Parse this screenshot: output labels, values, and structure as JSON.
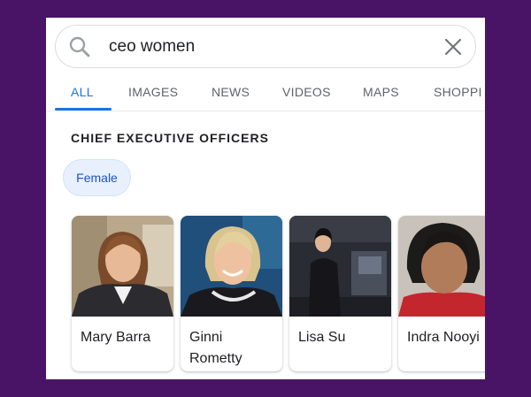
{
  "search": {
    "query": "ceo women",
    "search_icon": "search-icon",
    "clear_icon": "close-icon"
  },
  "tabs": [
    {
      "label": "ALL",
      "active": true
    },
    {
      "label": "IMAGES",
      "active": false
    },
    {
      "label": "NEWS",
      "active": false
    },
    {
      "label": "VIDEOS",
      "active": false
    },
    {
      "label": "MAPS",
      "active": false
    },
    {
      "label": "SHOPPI",
      "active": false
    }
  ],
  "section": {
    "title": "CHIEF EXECUTIVE OFFICERS",
    "filter_chip": "Female"
  },
  "people": [
    {
      "name": "Mary Barra"
    },
    {
      "name": "Ginni Rometty"
    },
    {
      "name": "Lisa Su"
    },
    {
      "name": "Indra Nooyi"
    }
  ],
  "colors": {
    "background": "#4a1466",
    "accent": "#1a73e8",
    "chip_bg": "#e8f0fe",
    "text": "#202124",
    "muted": "#5f6368"
  }
}
